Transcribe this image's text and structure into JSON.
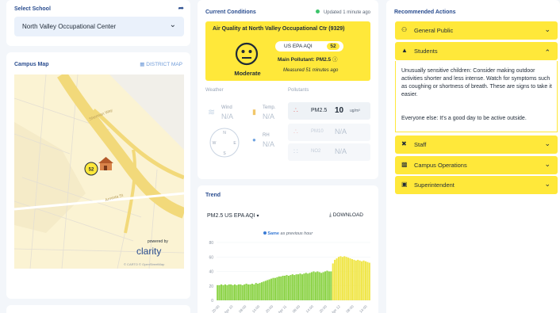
{
  "school": {
    "section_label": "Select School",
    "selected": "North Valley Occupational Center"
  },
  "map": {
    "title": "Campus Map",
    "district_link": "DISTRICT MAP",
    "marker_value": "52",
    "powered_by": "powered by",
    "brand": "clarity",
    "attribution": "© CARTO © OpenStreetMap",
    "street_1": "Sherman Way",
    "street_2": "Arminta St"
  },
  "conditions": {
    "title": "Current Conditions",
    "updated": "Updated 1 minute ago",
    "aq_title": "Air Quality at North Valley Occupational Ctr (9329)",
    "aqi_label": "US EPA AQI",
    "aqi_value": "52",
    "pollutant": "Main Pollutant: PM2.5",
    "status": "Moderate",
    "measured": "Measured 51 minutes ago",
    "weather_label": "Weather",
    "pollutants_label": "Pollutants",
    "wind_label": "Wind",
    "wind_value": "N/A",
    "temp_label": "Temp.",
    "temp_value": "N/A",
    "rh_label": "RH",
    "rh_value": "N/A",
    "compass": [
      "N",
      "E",
      "S",
      "W"
    ],
    "pollutants": [
      {
        "name": "PM2.5",
        "value": "10",
        "unit": "ug/m³"
      },
      {
        "name": "PM10",
        "value": "N/A",
        "unit": ""
      },
      {
        "name": "NO2",
        "value": "N/A",
        "unit": ""
      }
    ]
  },
  "trend": {
    "title": "Trend",
    "selector": "PM2.5 US EPA AQI",
    "download": "DOWNLOAD",
    "note_bold": "Same",
    "note_rest": "as previous hour"
  },
  "chart_data": {
    "type": "bar",
    "ylim": [
      0,
      80
    ],
    "y_ticks": [
      0,
      20,
      40,
      60,
      80
    ],
    "x_ticks": [
      "20:00",
      "Apr 10",
      "08:00",
      "14:00",
      "20:00",
      "Apr 11",
      "08:00",
      "14:00",
      "20:00",
      "Apr 12",
      "08:00",
      "14:00"
    ],
    "colors": {
      "good": "#8ed44a",
      "moderate": "#f0e64a"
    },
    "values": [
      21,
      21,
      22,
      21,
      22,
      21,
      22,
      22,
      21,
      22,
      21,
      22,
      22,
      21,
      22,
      23,
      22,
      22,
      23,
      22,
      24,
      23,
      24,
      25,
      26,
      27,
      28,
      29,
      30,
      31,
      31,
      32,
      33,
      33,
      34,
      34,
      35,
      34,
      35,
      36,
      35,
      36,
      36,
      37,
      36,
      37,
      38,
      37,
      38,
      39,
      40,
      39,
      40,
      39,
      38,
      39,
      40,
      41,
      40,
      40,
      51,
      56,
      58,
      60,
      61,
      60,
      61,
      60,
      59,
      58,
      57,
      56,
      55,
      56,
      55,
      54,
      55,
      54,
      53,
      52
    ]
  },
  "actions": {
    "title": "Recommended Actions",
    "items": [
      {
        "label": "General Public",
        "icon": "people-icon"
      },
      {
        "label": "Students",
        "icon": "graduation-cap-icon"
      },
      {
        "label": "Staff",
        "icon": "tools-icon"
      },
      {
        "label": "Campus Operations",
        "icon": "building-icon"
      },
      {
        "label": "Superintendent",
        "icon": "briefcase-icon"
      }
    ],
    "students_text_1": "Unusually sensitive children: Consider making outdoor activities shorter and less intense. Watch for symptoms such as coughing or shortness of breath. These are signs to take it easier.",
    "students_text_2": "Everyone else: It's a good day to be active outside."
  }
}
